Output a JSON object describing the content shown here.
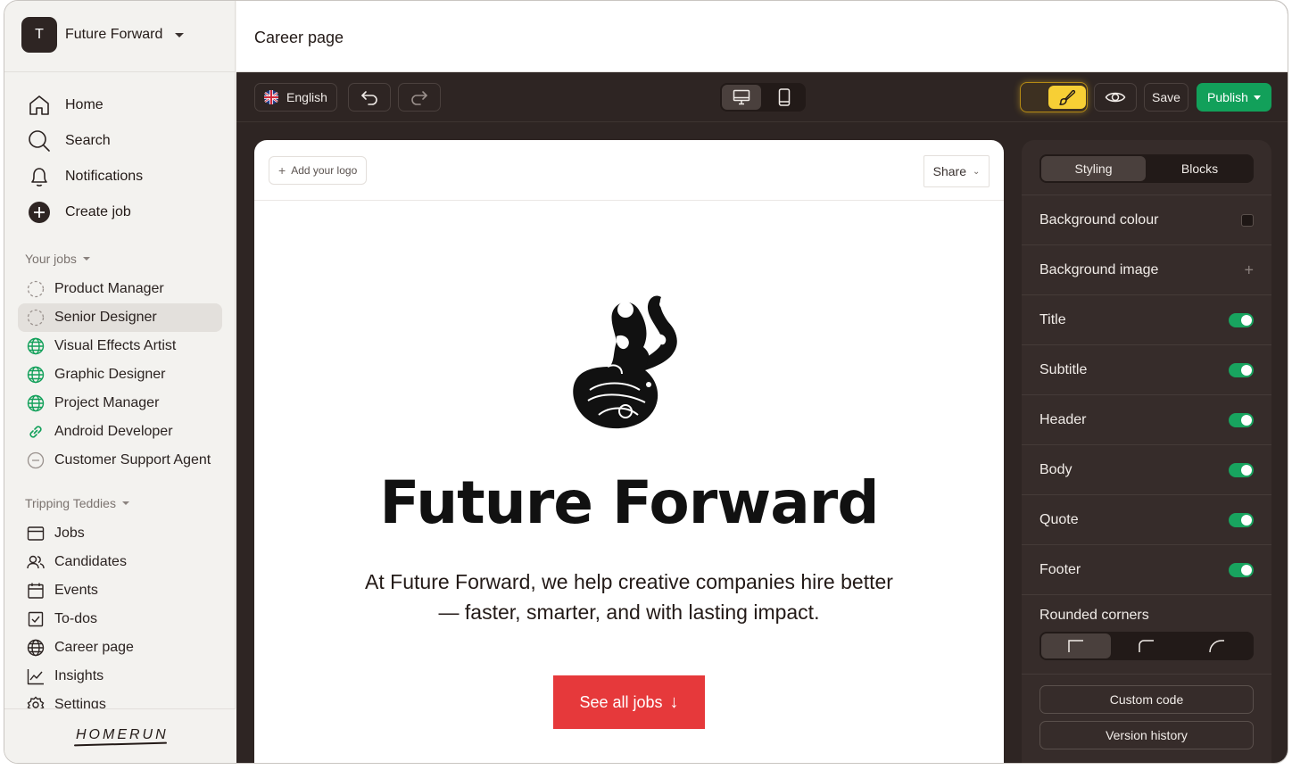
{
  "workspace": {
    "initial": "T",
    "name": "Future Forward"
  },
  "nav": {
    "home": "Home",
    "search": "Search",
    "notifications": "Notifications",
    "create_job": "Create job"
  },
  "your_jobs": {
    "label": "Your jobs",
    "items": [
      {
        "label": "Product Manager",
        "status": "draft"
      },
      {
        "label": "Senior Designer",
        "status": "draft",
        "active": true
      },
      {
        "label": "Visual Effects Artist",
        "status": "published"
      },
      {
        "label": "Graphic Designer",
        "status": "published"
      },
      {
        "label": "Project Manager",
        "status": "published"
      },
      {
        "label": "Android Developer",
        "status": "link"
      },
      {
        "label": "Customer Support Agent",
        "status": "closed"
      }
    ]
  },
  "team": {
    "label": "Tripping Teddies",
    "items": [
      {
        "label": "Jobs",
        "icon": "jobs-icon"
      },
      {
        "label": "Candidates",
        "icon": "candidates-icon"
      },
      {
        "label": "Events",
        "icon": "calendar-icon"
      },
      {
        "label": "To-dos",
        "icon": "checkbox-icon"
      },
      {
        "label": "Career page",
        "icon": "globe-icon"
      },
      {
        "label": "Insights",
        "icon": "chart-icon"
      },
      {
        "label": "Settings",
        "icon": "gear-icon"
      }
    ]
  },
  "brand": "HOMERUN",
  "page": {
    "title": "Career page"
  },
  "toolbar": {
    "language": "English",
    "save": "Save",
    "publish": "Publish"
  },
  "preview": {
    "add_logo": "Add your logo",
    "share": "Share",
    "title": "Future Forward",
    "subtitle": "At Future Forward, we help creative companies hire better — faster, smarter, and with lasting impact.",
    "cta": "See all jobs"
  },
  "panel": {
    "tabs": [
      "Styling",
      "Blocks"
    ],
    "active_tab": "Styling",
    "rows": {
      "background_colour": "Background colour",
      "background_image": "Background image",
      "title": "Title",
      "subtitle": "Subtitle",
      "header": "Header",
      "body": "Body",
      "quote": "Quote",
      "footer": "Footer"
    },
    "rounded_corners": "Rounded corners",
    "custom_code": "Custom code",
    "version_history": "Version history"
  },
  "colors": {
    "accent_green": "#12a05a",
    "cta_red": "#e6393b",
    "editor_dark": "#2e2523",
    "highlight_yellow": "#f7cf35"
  }
}
